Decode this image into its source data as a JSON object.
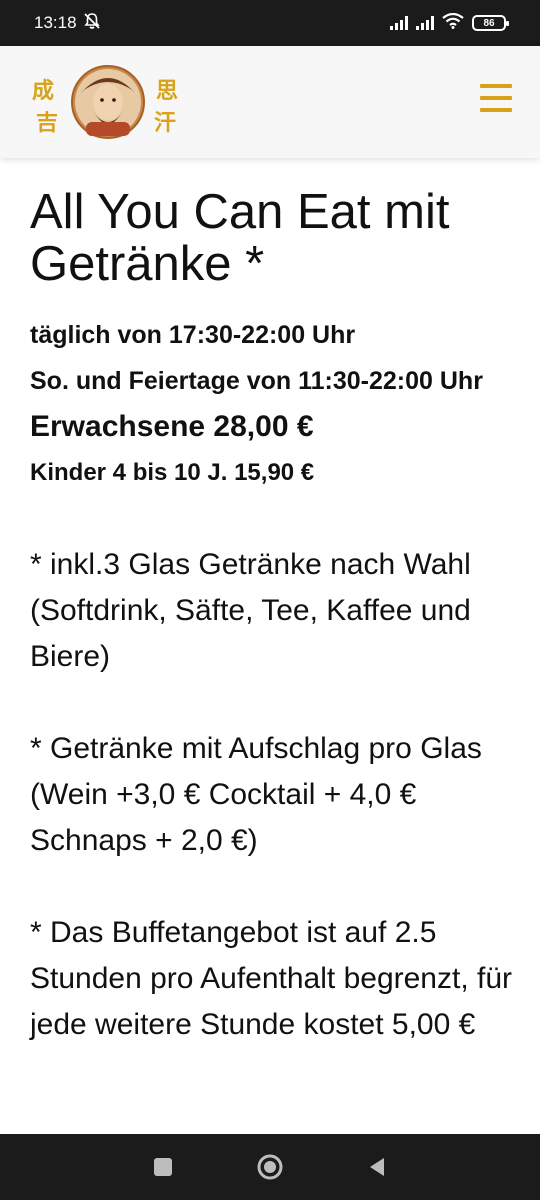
{
  "status_bar": {
    "time": "13:18",
    "battery": "86"
  },
  "header": {
    "logo_chars": [
      "成",
      "吉",
      "思",
      "汗"
    ]
  },
  "content": {
    "title": "All You Can Eat mit Getränke *",
    "hours_daily": "täglich von 17:30-22:00 Uhr",
    "hours_sunday": "So. und Feiertage von 11:30-22:00 Uhr",
    "price_adult": "Erwachsene 28,00 €",
    "price_kids": "Kinder 4 bis 10 J. 15,90 €",
    "note_drinks": "* inkl.3 Glas Getränke nach Wahl (Softdrink, Säfte, Tee, Kaffee und Biere)",
    "note_surcharge": "* Getränke mit Aufschlag pro Glas (Wein +3,0 € Cocktail + 4,0 € Schnaps + 2,0 €)",
    "note_buffet": "* Das Buffetangebot ist auf 2.5 Stunden pro Aufenthalt begrenzt, für jede weitere Stunde kostet 5,00 €"
  },
  "colors": {
    "accent": "#d9a21a",
    "system_bar": "#1b1b1b",
    "header_bg": "#f7f7f7"
  }
}
